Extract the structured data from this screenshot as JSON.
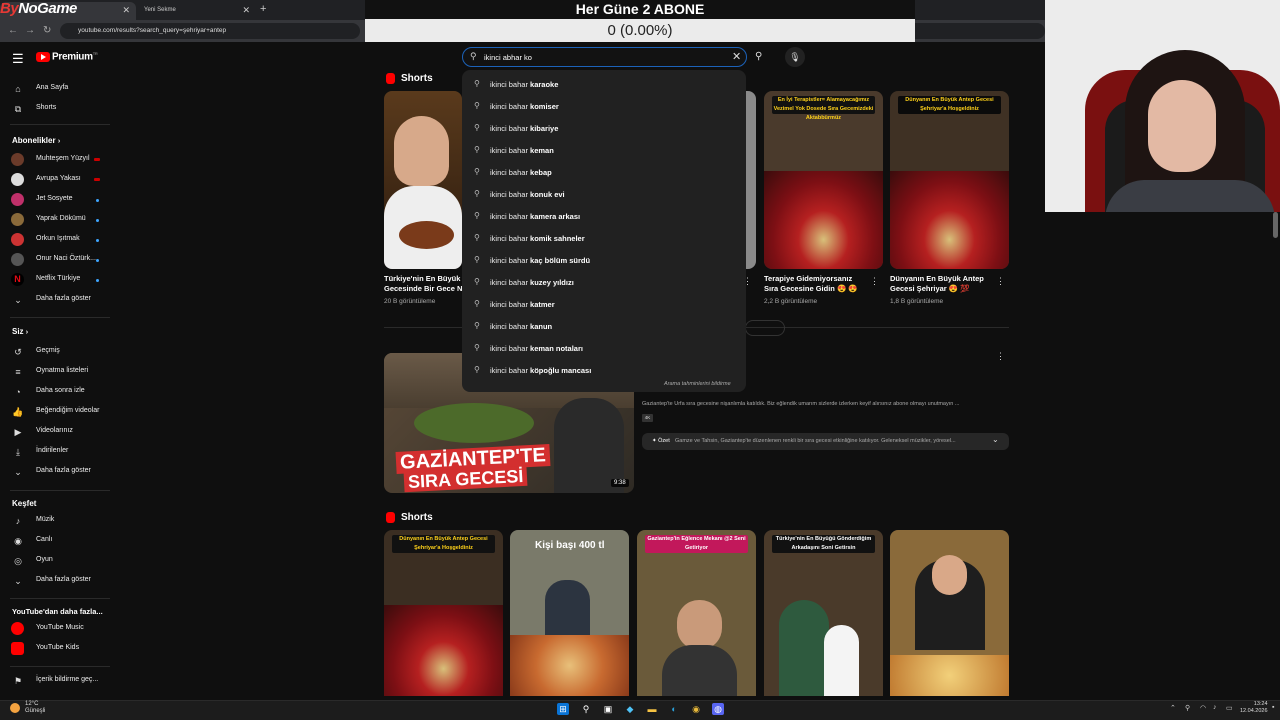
{
  "overlay": {
    "title": "Her Güne 2 ABONE",
    "counter": "0 (0.00%)",
    "left_num": "0",
    "right_num": "2"
  },
  "browser": {
    "tab1_logo_prefix": "By",
    "tab1_logo_rest": "NoGame",
    "tab2_title": "Yeni Sekme",
    "url": "youtube.com/results?search_query=şehriyar+antep"
  },
  "header": {
    "logo": "Premium",
    "logo_sup": "TR"
  },
  "search": {
    "query": "ikinci abhar ko"
  },
  "sidebar": {
    "home": "Ana Sayfa",
    "shorts": "Shorts",
    "subs_header": "Abonelikler",
    "subs": [
      "Muhteşem Yüzyıl",
      "Avrupa Yakası",
      "Jet Sosyete",
      "Yaprak Dökümü",
      "Orkun Işıtmak",
      "Onur Naci Öztürk...",
      "Netflix Türkiye"
    ],
    "more1": "Daha fazla göster",
    "you_header": "Siz",
    "you": [
      "Geçmiş",
      "Oynatma listeleri",
      "Daha sonra izle",
      "Beğendiğim videolar",
      "Videolarınız",
      "İndirilenler",
      "Daha fazla göster"
    ],
    "explore_header": "Keşfet",
    "explore": [
      "Müzik",
      "Canlı",
      "Oyun",
      "Daha fazla göster"
    ],
    "more_yt_header": "YouTube'dan daha fazla...",
    "more_yt": [
      "YouTube Music",
      "YouTube Kids"
    ],
    "report": "İçerik bildirme geç..."
  },
  "suggestions": {
    "prefix": "ikinci bahar ",
    "items": [
      "karaoke",
      "komiser",
      "kibariye",
      "keman",
      "kebap",
      "konuk evi",
      "kamera arkası",
      "komik sahneler",
      "kaç bölüm sürdü",
      "kuzey yıldızı",
      "katmer",
      "kanun",
      "keman notaları",
      "köpoğlu mancası"
    ],
    "report": "Arama tahminlerini bildirme"
  },
  "shorts1": {
    "title": "Shorts",
    "cards": [
      {
        "cap1": "Türkiye'nin En Büyük Ş",
        "cap2": "Gecesinde Bir Gece N",
        "views": "20 B görüntüleme"
      },
      {
        "cap1": "Terapiye Gidemiyorsanız",
        "cap2": "Sıra Gecesine Gidin 😍 😍",
        "views": "2,2 B görüntüleme",
        "banner": "En İyi Terapistler= Alamayacağımız Vezimel Yok Dosede Sıra Gecemizdeki Aktabbürmüz"
      },
      {
        "cap1": "Dünyanın En Büyük Antep",
        "cap2": "Gecesi Şehriyar 😍 💯",
        "views": "1,8 B görüntüleme",
        "banner": "Dünyanın En Büyük Antep Gecesi Şehriyar'a Hoşgeldiniz"
      }
    ]
  },
  "video": {
    "thumb_text1": "GAZİANTEP'TE",
    "thumb_text2": "SIRA GECESİ",
    "duration": "9:38",
    "desc": "Gaziantep'te Urfa sıra gecesine nişanlımla katıldık. Biz eğlendik umarım sizlerde izlerken keyif alırsınız abone olmayı unutmayın ...",
    "badge": "4K",
    "summary_label": "Özet",
    "summary_text": "Gamze ve Tahsin, Gaziantep'te düzenlenen renkli bir sıra gecesi etkinliğine katılıyor. Geleneksel müzikler, yöresel..."
  },
  "shorts2": {
    "title": "Shorts",
    "banners": [
      "Dünyanın En Büyük Antep Gecesi Şehriyar'a Hoşgeldiniz",
      "Kişi başı 400 tl",
      "Gaziantep'in Eğlence Mekanı @2 Seni Getiriyor",
      "Türkiye'nin En Büyüğü Gönderdiğim Arkadaşını Soni Getirsin",
      ""
    ]
  },
  "taskbar": {
    "temp": "12°C",
    "cond": "Güneşli",
    "time": "13:24",
    "date": "12.04.2026"
  }
}
